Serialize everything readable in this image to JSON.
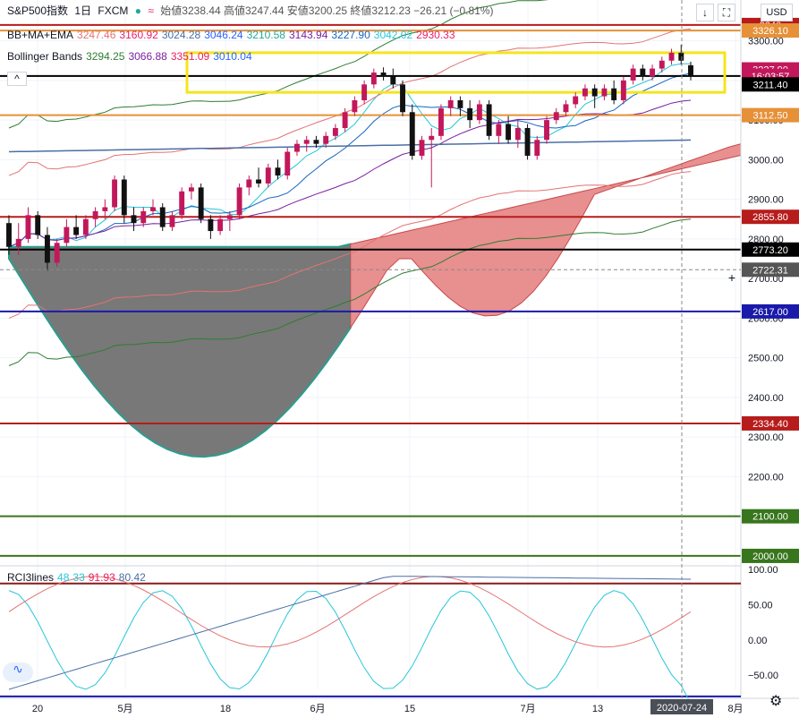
{
  "header": {
    "symbol": "S&P500指数",
    "timeframe": "1日",
    "source": "FXCM",
    "ohlc_text": "始値3238.44 高値3247.44 安値3200.25 終値3212.23 −26.21 (−0.81%)",
    "currency_button": "USD"
  },
  "indicators": [
    {
      "name": "BB+MA+EMA",
      "values": [
        "3247.46",
        "3160.92",
        "3024.28",
        "3046.24",
        "3210.58",
        "3143.94",
        "3227.90",
        "3042.02",
        "2930.33"
      ],
      "colors": [
        "#e57373",
        "#e91e63",
        "#4a6fa5",
        "#2962ff",
        "#26a69a",
        "#7b1fa2",
        "#1565c0",
        "#26c6da",
        "#e91e63"
      ]
    },
    {
      "name": "Bollinger Bands",
      "values": [
        "3294.25",
        "3066.88",
        "3351.09",
        "3010.04"
      ],
      "colors": [
        "#2e7d32",
        "#7b1fa2",
        "#e91e63",
        "#2962ff"
      ]
    }
  ],
  "rci": {
    "name": "RCI3lines",
    "values": [
      "48",
      "33",
      "91.93",
      "80.42"
    ],
    "colors": [
      "#26c6da",
      "#26c6da",
      "#e91e63",
      "#4a6fa5"
    ]
  },
  "price_axis": {
    "tick_labels": [
      "3300.00",
      "3200.00",
      "3100.00",
      "3000.00",
      "2900.00",
      "2800.00",
      "2700.00",
      "2600.00",
      "2500.00",
      "2400.00",
      "2300.00",
      "2200.00",
      "2100.00",
      "2000.00"
    ],
    "rci_tick_labels": [
      "100.00",
      "50.00",
      "0.00",
      "−50.00"
    ]
  },
  "time_axis": {
    "labels": [
      "20",
      "5月",
      "18",
      "6月",
      "15",
      "7月",
      "13",
      "8月"
    ],
    "cursor_label": "2020-07-24"
  },
  "price_labels": [
    {
      "value": 3340,
      "text": "3340",
      "color": "#b71c1c"
    },
    {
      "value": 3326.1,
      "text": "3326.10",
      "color": "#e69138"
    },
    {
      "value": 3227.9,
      "text": "3227.90",
      "color": "#c2185b"
    },
    {
      "value": 3211.4,
      "text": "16:03:57",
      "color": "#c2185b"
    },
    {
      "value": 3190,
      "text": "3211.40",
      "color": "#000000"
    },
    {
      "value": 3112.5,
      "text": "3112.50",
      "color": "#e69138"
    },
    {
      "value": 2855.8,
      "text": "2855.80",
      "color": "#b71c1c"
    },
    {
      "value": 2773.2,
      "text": "2773.20",
      "color": "#000000"
    },
    {
      "value": 2722.31,
      "text": "2722.31",
      "color": "#555555"
    },
    {
      "value": 2617.0,
      "text": "2617.00",
      "color": "#1a1aaa"
    },
    {
      "value": 2334.4,
      "text": "2334.40",
      "color": "#b71c1c"
    },
    {
      "value": 2100.0,
      "text": "2100.00",
      "color": "#38761d"
    },
    {
      "value": 2000.0,
      "text": "2000.00",
      "color": "#38761d"
    }
  ],
  "chart_data": {
    "type": "candlestick",
    "title": "S&P500指数 1日 FXCM",
    "ylim": [
      1975,
      3385
    ],
    "rci_ylim": [
      -70,
      105
    ],
    "horizontal_levels": [
      {
        "price": 3340,
        "color": "#b71c1c"
      },
      {
        "price": 3326.1,
        "color": "#e69138"
      },
      {
        "price": 3211.4,
        "color": "#000000"
      },
      {
        "price": 3112.5,
        "color": "#e69138"
      },
      {
        "price": 2855.8,
        "color": "#b71c1c"
      },
      {
        "price": 2773.2,
        "color": "#000000"
      },
      {
        "price": 2617.0,
        "color": "#1a1aaa"
      },
      {
        "price": 2334.4,
        "color": "#b71c1c"
      },
      {
        "price": 2100.0,
        "color": "#38761d"
      },
      {
        "price": 2000.0,
        "color": "#38761d"
      }
    ],
    "highlight_box": {
      "from_price": 3170,
      "to_price": 3270,
      "color": "#f5e51d"
    },
    "candles": [
      [
        2840,
        2860,
        2760,
        2780
      ],
      [
        2780,
        2840,
        2760,
        2800
      ],
      [
        2800,
        2880,
        2790,
        2860
      ],
      [
        2860,
        2870,
        2800,
        2810
      ],
      [
        2810,
        2830,
        2720,
        2740
      ],
      [
        2740,
        2800,
        2730,
        2790
      ],
      [
        2790,
        2850,
        2780,
        2830
      ],
      [
        2830,
        2860,
        2800,
        2810
      ],
      [
        2810,
        2860,
        2800,
        2850
      ],
      [
        2850,
        2880,
        2830,
        2870
      ],
      [
        2870,
        2900,
        2850,
        2880
      ],
      [
        2880,
        2960,
        2870,
        2950
      ],
      [
        2950,
        2960,
        2840,
        2860
      ],
      [
        2860,
        2880,
        2820,
        2840
      ],
      [
        2840,
        2880,
        2830,
        2870
      ],
      [
        2870,
        2900,
        2860,
        2880
      ],
      [
        2880,
        2890,
        2820,
        2830
      ],
      [
        2830,
        2870,
        2820,
        2860
      ],
      [
        2860,
        2930,
        2850,
        2920
      ],
      [
        2920,
        2940,
        2900,
        2930
      ],
      [
        2930,
        2940,
        2840,
        2850
      ],
      [
        2850,
        2860,
        2800,
        2820
      ],
      [
        2820,
        2860,
        2810,
        2850
      ],
      [
        2850,
        2870,
        2820,
        2860
      ],
      [
        2860,
        2940,
        2850,
        2930
      ],
      [
        2930,
        2960,
        2910,
        2950
      ],
      [
        2950,
        2980,
        2930,
        2940
      ],
      [
        2940,
        2990,
        2930,
        2980
      ],
      [
        2980,
        3000,
        2950,
        2960
      ],
      [
        2960,
        3030,
        2950,
        3020
      ],
      [
        3020,
        3050,
        3010,
        3040
      ],
      [
        3040,
        3060,
        3020,
        3050
      ],
      [
        3050,
        3060,
        3030,
        3040
      ],
      [
        3040,
        3070,
        3030,
        3060
      ],
      [
        3060,
        3090,
        3050,
        3080
      ],
      [
        3080,
        3130,
        3070,
        3120
      ],
      [
        3120,
        3160,
        3110,
        3150
      ],
      [
        3150,
        3200,
        3140,
        3190
      ],
      [
        3190,
        3230,
        3180,
        3220
      ],
      [
        3220,
        3233,
        3200,
        3210
      ],
      [
        3210,
        3230,
        3180,
        3190
      ],
      [
        3190,
        3200,
        3110,
        3120
      ],
      [
        3120,
        3140,
        3000,
        3010
      ],
      [
        3010,
        3060,
        3000,
        3050
      ],
      [
        3050,
        3080,
        2930,
        3060
      ],
      [
        3060,
        3140,
        3050,
        3130
      ],
      [
        3130,
        3160,
        3110,
        3150
      ],
      [
        3150,
        3160,
        3110,
        3130
      ],
      [
        3130,
        3150,
        3080,
        3100
      ],
      [
        3100,
        3150,
        3090,
        3140
      ],
      [
        3140,
        3150,
        3050,
        3060
      ],
      [
        3060,
        3100,
        3040,
        3090
      ],
      [
        3090,
        3110,
        3040,
        3050
      ],
      [
        3050,
        3100,
        3030,
        3080
      ],
      [
        3080,
        3090,
        3000,
        3010
      ],
      [
        3010,
        3060,
        3000,
        3050
      ],
      [
        3050,
        3110,
        3040,
        3100
      ],
      [
        3100,
        3130,
        3090,
        3120
      ],
      [
        3120,
        3150,
        3110,
        3140
      ],
      [
        3140,
        3170,
        3130,
        3160
      ],
      [
        3160,
        3190,
        3150,
        3180
      ],
      [
        3180,
        3190,
        3130,
        3160
      ],
      [
        3160,
        3190,
        3150,
        3180
      ],
      [
        3180,
        3200,
        3140,
        3150
      ],
      [
        3150,
        3210,
        3140,
        3200
      ],
      [
        3200,
        3240,
        3190,
        3230
      ],
      [
        3230,
        3240,
        3200,
        3210
      ],
      [
        3210,
        3240,
        3200,
        3230
      ],
      [
        3230,
        3260,
        3220,
        3250
      ],
      [
        3250,
        3280,
        3240,
        3270
      ],
      [
        3270,
        3290,
        3240,
        3250
      ],
      [
        3238.44,
        3247.44,
        3200.25,
        3212.23
      ]
    ]
  }
}
